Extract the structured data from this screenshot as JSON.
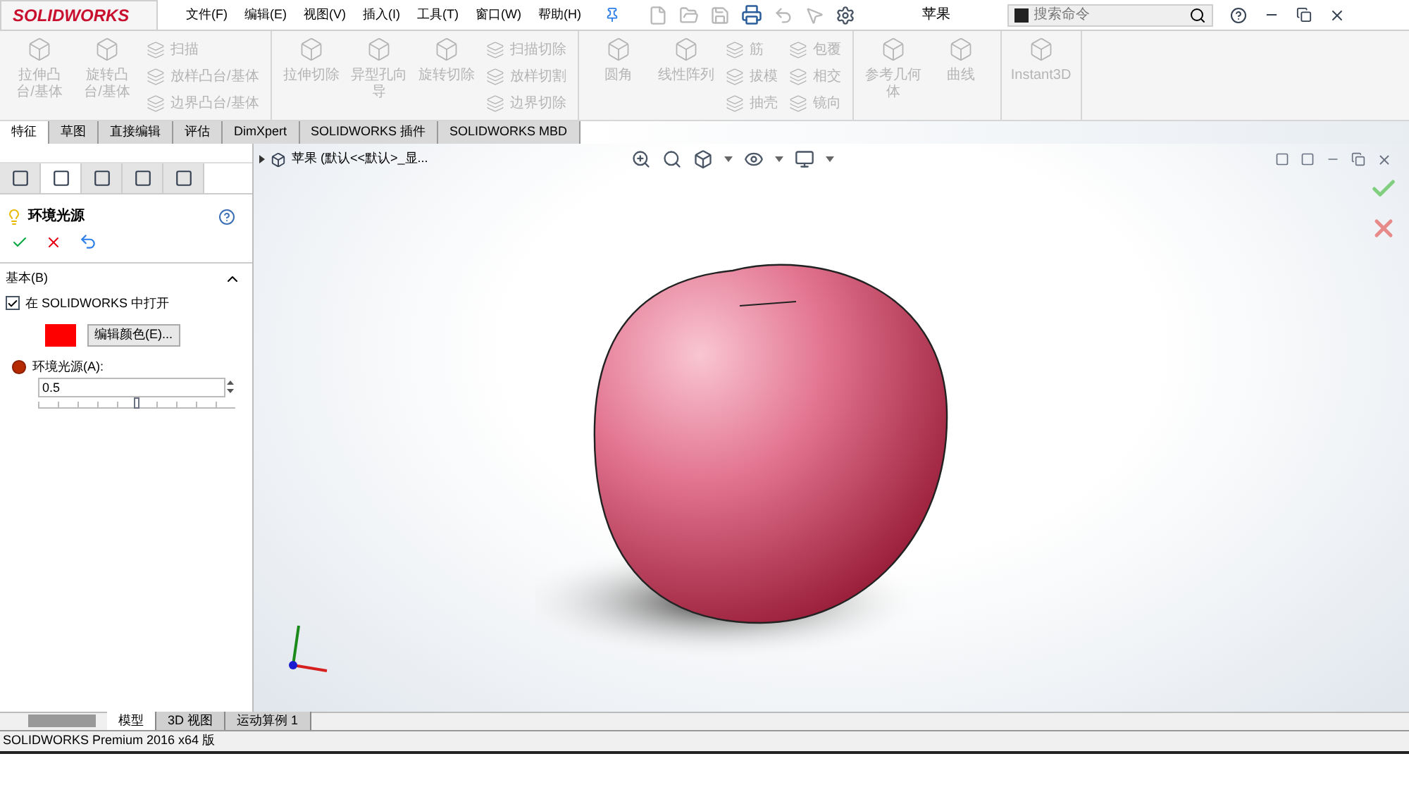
{
  "app": {
    "logo": "SOLIDWORKS",
    "menu": [
      "文件(F)",
      "编辑(E)",
      "视图(V)",
      "插入(I)",
      "工具(T)",
      "窗口(W)",
      "帮助(H)"
    ],
    "document_title": "苹果",
    "search": {
      "placeholder": "搜索命令"
    }
  },
  "ribbon": [
    {
      "items": [
        {
          "kind": "large",
          "label": "拉伸凸台/基体",
          "disabled": true
        },
        {
          "kind": "large",
          "label": "旋转凸台/基体",
          "disabled": true
        },
        {
          "kind": "small",
          "label": "扫描",
          "disabled": true
        },
        {
          "kind": "small",
          "label": "放样凸台/基体",
          "disabled": true
        },
        {
          "kind": "small",
          "label": "边界凸台/基体",
          "disabled": true
        }
      ]
    },
    {
      "items": [
        {
          "kind": "large",
          "label": "拉伸切除",
          "disabled": true
        },
        {
          "kind": "large",
          "label": "异型孔向导",
          "disabled": true
        },
        {
          "kind": "large",
          "label": "旋转切除",
          "disabled": true
        },
        {
          "kind": "small",
          "label": "扫描切除",
          "disabled": true
        },
        {
          "kind": "small",
          "label": "放样切割",
          "disabled": true
        },
        {
          "kind": "small",
          "label": "边界切除",
          "disabled": true
        }
      ]
    },
    {
      "items": [
        {
          "kind": "large",
          "label": "圆角",
          "disabled": true
        },
        {
          "kind": "large",
          "label": "线性阵列",
          "disabled": true
        },
        {
          "kind": "small",
          "label": "筋",
          "disabled": true
        },
        {
          "kind": "small",
          "label": "拔模",
          "disabled": true
        },
        {
          "kind": "small",
          "label": "抽壳",
          "disabled": true
        },
        {
          "kind": "small",
          "label": "包覆",
          "disabled": true
        },
        {
          "kind": "small",
          "label": "相交",
          "disabled": true
        },
        {
          "kind": "small",
          "label": "镜向",
          "disabled": true
        }
      ]
    },
    {
      "items": [
        {
          "kind": "large",
          "label": "参考几何体",
          "disabled": true
        },
        {
          "kind": "large",
          "label": "曲线",
          "disabled": true
        }
      ]
    },
    {
      "items": [
        {
          "kind": "large",
          "label": "Instant3D",
          "disabled": true
        }
      ]
    }
  ],
  "tabs": [
    {
      "label": "特征",
      "selected": true
    },
    {
      "label": "草图",
      "selected": false
    },
    {
      "label": "直接编辑",
      "selected": false
    },
    {
      "label": "评估",
      "selected": false
    },
    {
      "label": "DimXpert",
      "selected": false
    },
    {
      "label": "SOLIDWORKS 插件",
      "selected": false
    },
    {
      "label": "SOLIDWORKS MBD",
      "selected": false
    }
  ],
  "panel_tabs": [
    {
      "selected": false
    },
    {
      "selected": true
    },
    {
      "selected": false
    },
    {
      "selected": false
    },
    {
      "selected": false
    }
  ],
  "property_manager": {
    "title": "环境光源",
    "section": "基本(B)",
    "open_in_solidworks": {
      "label": "在 SOLIDWORKS 中打开",
      "checked": true
    },
    "color": "#ff0000",
    "edit_color_button": "编辑颜色(E)...",
    "ambient": {
      "label": "环境光源(A):",
      "value": "0.5",
      "level": 0.5
    }
  },
  "feature_tree": {
    "label": "苹果 (默认<<默认>_显..."
  },
  "bottom_tabs": [
    {
      "label": "模型",
      "selected": true
    },
    {
      "label": "3D 视图",
      "selected": false
    },
    {
      "label": "运动算例 1",
      "selected": false
    }
  ],
  "status_bar": "SOLIDWORKS Premium 2016 x64 版"
}
